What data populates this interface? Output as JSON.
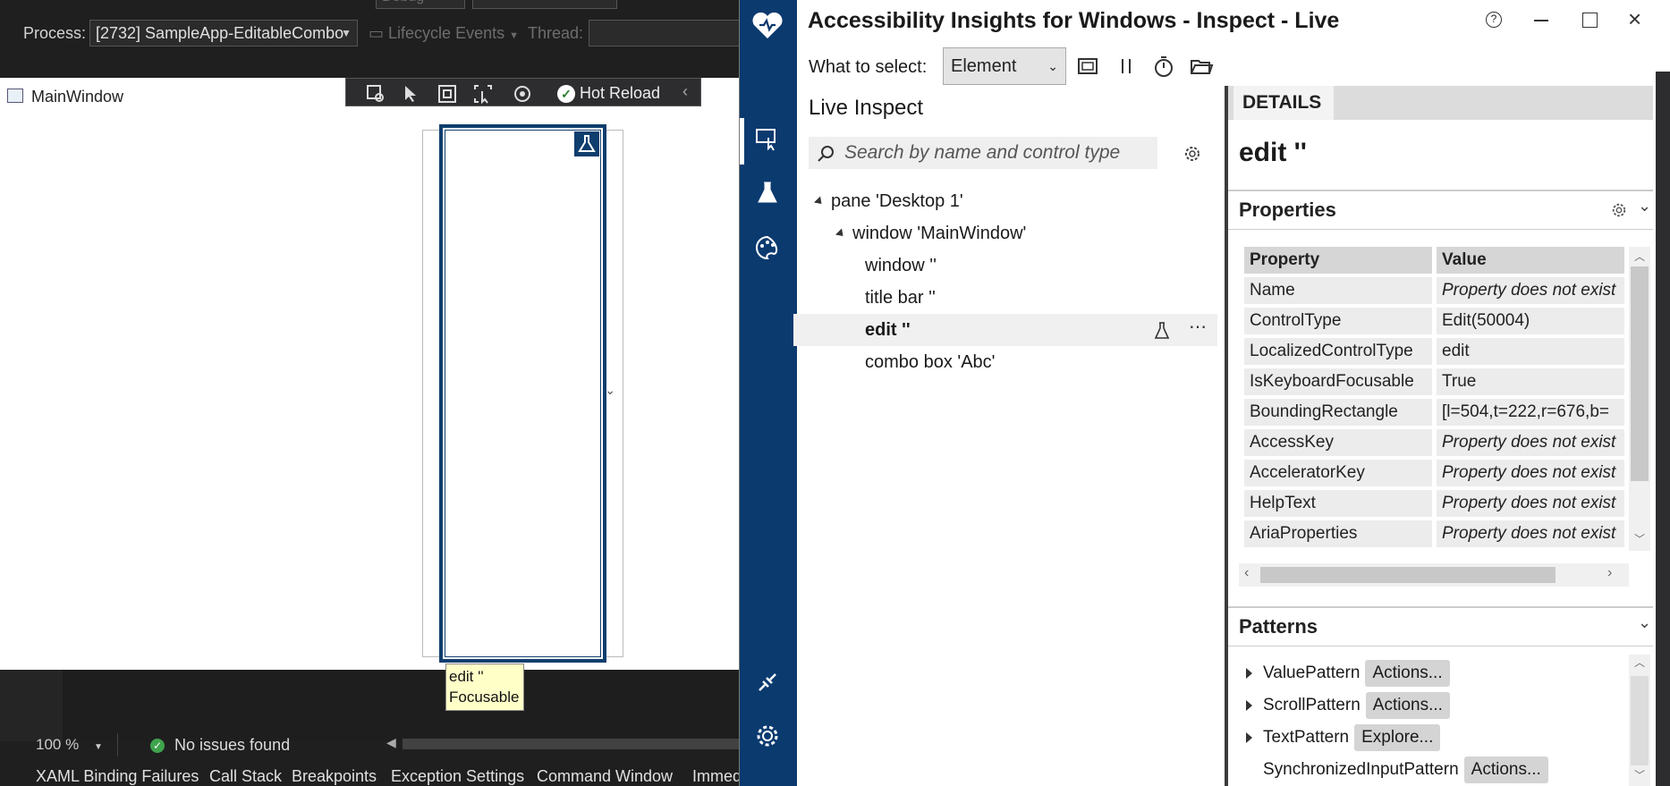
{
  "vs": {
    "process_label": "Process:",
    "process_value": "[2732] SampleApp-EditableCombo",
    "lifecycle_label": "Lifecycle Events",
    "thread_label": "Thread:",
    "debug_value": "Debug",
    "hot_reload_label": "Hot Reload",
    "zoom_value": "100 %",
    "issues_label": "No issues found",
    "bottom_tabs": [
      "XAML Binding Failures",
      "Call Stack",
      "Breakpoints",
      "Exception Settings",
      "Command Window",
      "Immed"
    ]
  },
  "wpf": {
    "title": "MainWindow",
    "tooltip_line1": "edit ''",
    "tooltip_line2": "Focusable"
  },
  "ai": {
    "title": "Accessibility Insights for Windows - Inspect - Live",
    "select_label": "What to select:",
    "select_value": "Element",
    "live_inspect_title": "Live Inspect",
    "search_placeholder": "Search by name and control type",
    "tree": [
      {
        "label": "pane 'Desktop 1'",
        "level": 0,
        "expanded": true
      },
      {
        "label": "window 'MainWindow'",
        "level": 1,
        "expanded": true
      },
      {
        "label": "window ''",
        "level": 2
      },
      {
        "label": "title bar ''",
        "level": 2
      },
      {
        "label": "edit ''",
        "level": 2,
        "selected": true
      },
      {
        "label": "combo box 'Abc'",
        "level": 2
      }
    ],
    "details_tab": "DETAILS",
    "element_title": "edit ''",
    "properties_title": "Properties",
    "prop_header": {
      "key": "Property",
      "value": "Value"
    },
    "properties": [
      {
        "key": "Name",
        "value": "Property does not exist",
        "missing": true
      },
      {
        "key": "ControlType",
        "value": "Edit(50004)",
        "missing": false
      },
      {
        "key": "LocalizedControlType",
        "value": "edit",
        "missing": false
      },
      {
        "key": "IsKeyboardFocusable",
        "value": "True",
        "missing": false
      },
      {
        "key": "BoundingRectangle",
        "value": "[l=504,t=222,r=676,b=",
        "missing": false
      },
      {
        "key": "AccessKey",
        "value": "Property does not exist",
        "missing": true
      },
      {
        "key": "AcceleratorKey",
        "value": "Property does not exist",
        "missing": true
      },
      {
        "key": "HelpText",
        "value": "Property does not exist",
        "missing": true
      },
      {
        "key": "AriaProperties",
        "value": "Property does not exist",
        "missing": true
      }
    ],
    "patterns_title": "Patterns",
    "patterns": [
      {
        "name": "ValuePattern",
        "action": "Actions..."
      },
      {
        "name": "ScrollPattern",
        "action": "Actions..."
      },
      {
        "name": "TextPattern",
        "action": "Explore..."
      },
      {
        "name": "SynchronizedInputPattern",
        "action": "Actions..."
      }
    ]
  },
  "colors": {
    "ai_sidebar": "#0b3a6f",
    "highlight_border": "#0f3e6e",
    "tooltip_bg": "#ffffc8"
  }
}
